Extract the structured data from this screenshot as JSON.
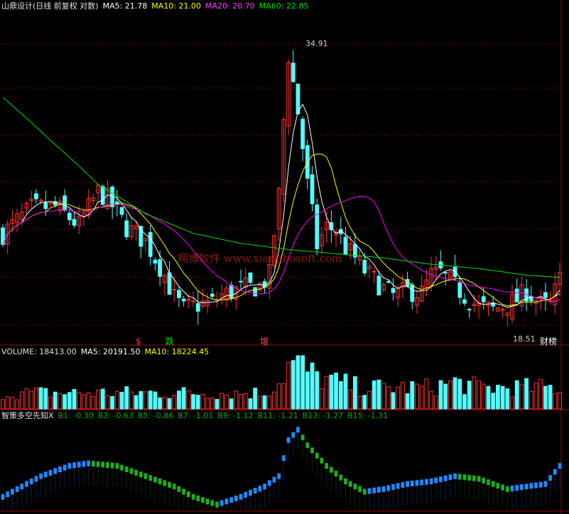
{
  "colors": {
    "background": "#000000",
    "up": "#ff3232",
    "down": "#54fcfc",
    "ma5": "#ffffff",
    "ma10": "#ffff00",
    "ma20": "#ff00ff",
    "ma60": "#00e000",
    "grid": "#800000",
    "bull_bar": "#2288ff",
    "bear_bar": "#22aa22"
  },
  "price_panel": {
    "title": "山鼎设计(日线 前复权 对数)",
    "ma5_label": "MA5: 21.78",
    "ma10_label": "MA10: 21.00",
    "ma20_label": "MA20: 20.70",
    "ma60_label": "MA60: 22.85",
    "high_marker": "34.91",
    "low_marker": "18.51",
    "event_labels": [
      "跌",
      "增",
      "财榜"
    ],
    "red_glyph": "$",
    "watermark": "翔博软件 www.xiangbosoft.com"
  },
  "volume_panel": {
    "title": "VOLUME: 18413.00",
    "ma5_label": "MA5: 20191.50",
    "ma10_label": "MA10: 18224.45"
  },
  "indicator_panel": {
    "title": "智策多空先知X",
    "b1": "B1: -0.30",
    "b3": "B3: -0.63",
    "b5": "B5: -0.86",
    "b7": "B7: -1.01",
    "b9": "B9: -1.12",
    "b11": "B11: -1.21",
    "b13": "B13: -1.27",
    "b15": "B15: -1.31"
  },
  "chart_data": {
    "type": "candlestick",
    "x_count": 118,
    "close_path": [
      [
        0,
        21.6
      ],
      [
        5,
        22.5
      ],
      [
        10,
        22.4
      ],
      [
        15,
        21.8
      ],
      [
        20,
        23.2
      ],
      [
        25,
        22.0
      ],
      [
        30,
        23.2
      ],
      [
        35,
        22.5
      ],
      [
        40,
        21.8
      ],
      [
        45,
        20.2
      ],
      [
        50,
        19.8
      ],
      [
        55,
        20.4
      ],
      [
        60,
        21.5
      ],
      [
        65,
        21.0
      ],
      [
        70,
        20.5
      ],
      [
        75,
        20.1
      ],
      [
        80,
        20.0
      ],
      [
        85,
        20.7
      ],
      [
        90,
        20.3
      ],
      [
        95,
        20.6
      ],
      [
        100,
        20.2
      ],
      [
        105,
        19.6
      ],
      [
        110,
        18.9
      ],
      [
        115,
        19.3
      ],
      [
        117,
        20.0
      ]
    ],
    "path_points": [
      [
        0,
        22.0
      ],
      [
        6,
        23.3
      ],
      [
        11,
        23.4
      ],
      [
        16,
        22.4
      ],
      [
        20,
        24.2
      ],
      [
        22,
        23.8
      ],
      [
        26,
        22.3
      ],
      [
        30,
        21.6
      ],
      [
        34,
        20.0
      ],
      [
        36,
        19.0
      ],
      [
        38,
        18.5
      ],
      [
        41,
        18.7
      ],
      [
        44,
        18.8
      ],
      [
        46,
        19.1
      ],
      [
        50,
        19.4
      ],
      [
        54,
        19.5
      ],
      [
        56,
        20.0
      ],
      [
        58,
        24.0
      ],
      [
        60,
        33.0
      ],
      [
        62,
        29.0
      ],
      [
        64,
        24.6
      ],
      [
        66,
        21.4
      ],
      [
        68,
        22.3
      ],
      [
        70,
        22.2
      ],
      [
        72,
        21.3
      ],
      [
        74,
        20.8
      ],
      [
        76,
        20.2
      ],
      [
        78,
        19.8
      ],
      [
        80,
        19.4
      ],
      [
        82,
        19.1
      ],
      [
        85,
        19.3
      ],
      [
        88,
        19.2
      ],
      [
        90,
        20.0
      ],
      [
        92,
        20.1
      ],
      [
        94,
        19.7
      ],
      [
        96,
        19.3
      ],
      [
        98,
        18.9
      ],
      [
        100,
        18.6
      ],
      [
        103,
        18.5
      ],
      [
        106,
        18.7
      ],
      [
        108,
        18.9
      ],
      [
        110,
        19.3
      ],
      [
        113,
        18.7
      ],
      [
        115,
        18.7
      ],
      [
        117,
        19.8
      ]
    ],
    "ma60_path": [
      [
        0,
        30.0
      ],
      [
        10,
        27.2
      ],
      [
        20,
        24.6
      ],
      [
        30,
        23.0
      ],
      [
        40,
        22.0
      ],
      [
        50,
        21.5
      ],
      [
        60,
        21.2
      ],
      [
        70,
        21.0
      ],
      [
        80,
        20.8
      ],
      [
        90,
        20.5
      ],
      [
        100,
        20.3
      ],
      [
        110,
        20.0
      ],
      [
        117,
        19.9
      ]
    ],
    "volume_level_path": [
      [
        0,
        3
      ],
      [
        55,
        3
      ],
      [
        58,
        5
      ],
      [
        60,
        8
      ],
      [
        62,
        9
      ],
      [
        64,
        7
      ],
      [
        66,
        6
      ],
      [
        70,
        5
      ],
      [
        75,
        4
      ],
      [
        80,
        4
      ],
      [
        90,
        4
      ],
      [
        95,
        5
      ],
      [
        100,
        4
      ],
      [
        110,
        4
      ],
      [
        117,
        4
      ]
    ],
    "indicator_path": [
      [
        0,
        -1.2
      ],
      [
        8,
        -0.8
      ],
      [
        14,
        -0.6
      ],
      [
        18,
        -0.55
      ],
      [
        24,
        -0.6
      ],
      [
        30,
        -0.8
      ],
      [
        36,
        -1.0
      ],
      [
        40,
        -1.2
      ],
      [
        45,
        -1.35
      ],
      [
        50,
        -1.2
      ],
      [
        55,
        -1.0
      ],
      [
        58,
        -0.8
      ],
      [
        60,
        -0.1
      ],
      [
        62,
        0.1
      ],
      [
        64,
        -0.2
      ],
      [
        68,
        -0.6
      ],
      [
        72,
        -0.9
      ],
      [
        76,
        -1.1
      ],
      [
        80,
        -1.05
      ],
      [
        85,
        -0.95
      ],
      [
        90,
        -0.9
      ],
      [
        95,
        -0.8
      ],
      [
        100,
        -0.85
      ],
      [
        103,
        -0.95
      ],
      [
        106,
        -1.05
      ],
      [
        110,
        -1.0
      ],
      [
        114,
        -0.95
      ],
      [
        117,
        -0.6
      ]
    ],
    "y_range": [
      17.5,
      36.5
    ],
    "log_scale": true,
    "grid": true
  }
}
